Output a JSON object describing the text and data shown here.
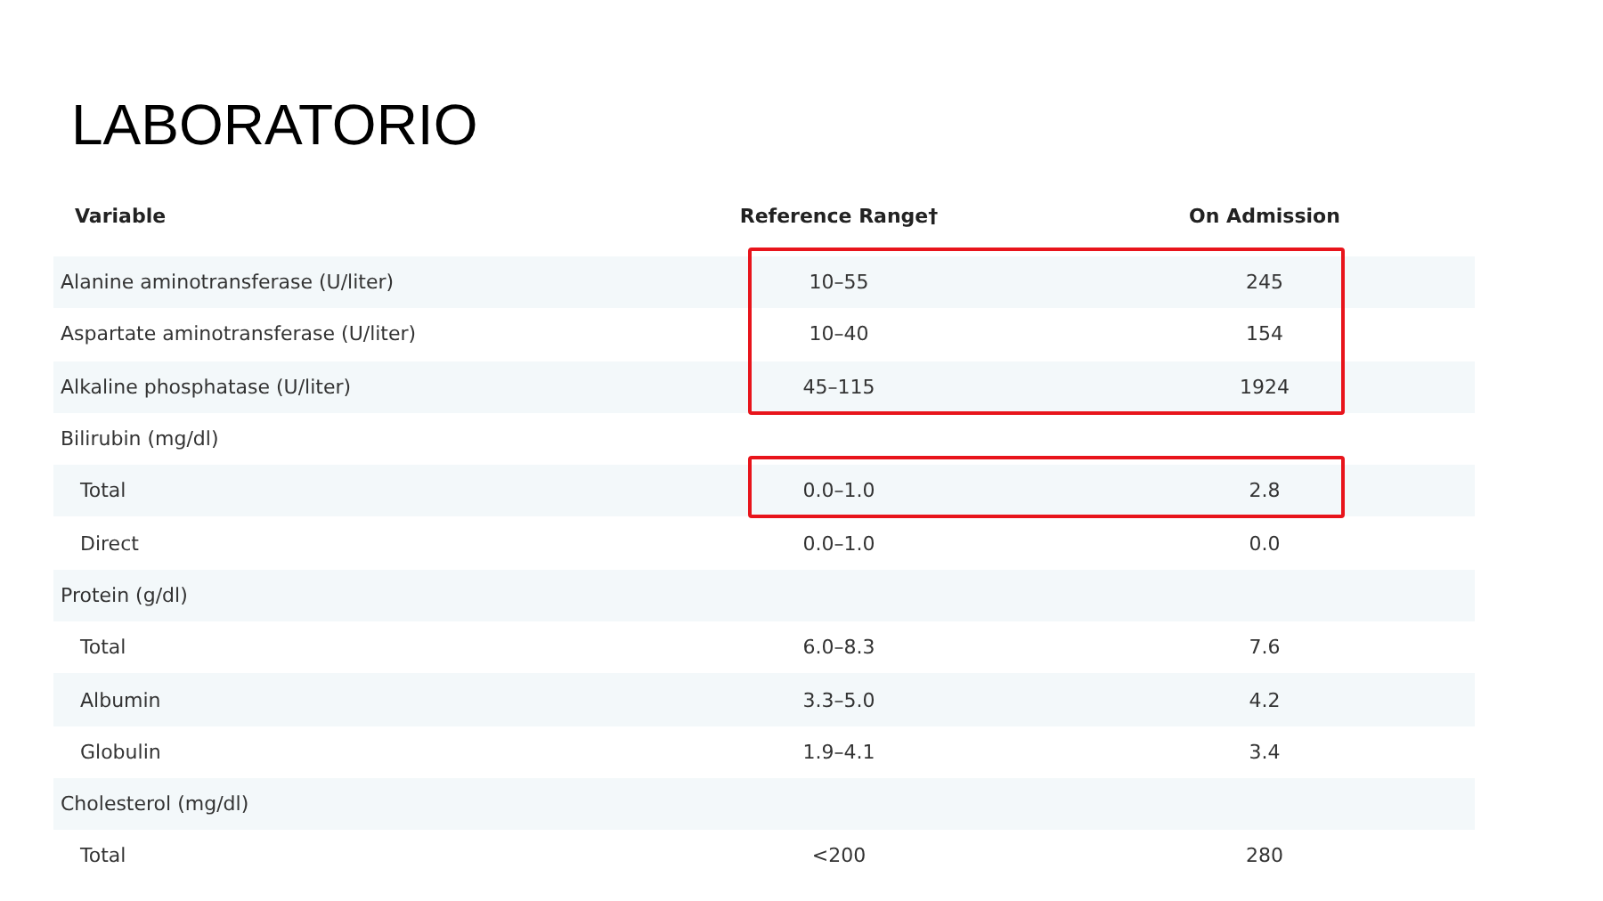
{
  "title": "LABORATORIO",
  "table": {
    "columns": [
      "Variable",
      "Reference Range†",
      "On Admission"
    ],
    "rows": [
      {
        "variable": "Alanine aminotransferase (U/liter)",
        "reference": "10–55",
        "admission": "245",
        "highlighted": true
      },
      {
        "variable": "Aspartate aminotransferase (U/liter)",
        "reference": "10–40",
        "admission": "154",
        "highlighted": true
      },
      {
        "variable": "Alkaline phosphatase (U/liter)",
        "reference": "45–115",
        "admission": "1924",
        "highlighted": true
      },
      {
        "variable": "Bilirubin (mg/dl)",
        "highlighted": false,
        "children": [
          {
            "variable": "Total",
            "reference": "0.0–1.0",
            "admission": "2.8",
            "highlighted": true
          },
          {
            "variable": "Direct",
            "reference": "0.0–1.0",
            "admission": "0.0",
            "highlighted": false
          }
        ]
      },
      {
        "variable": "Protein (g/dl)",
        "highlighted": false,
        "children": [
          {
            "variable": "Total",
            "reference": "6.0–8.3",
            "admission": "7.6",
            "highlighted": false
          },
          {
            "variable": "Albumin",
            "reference": "3.3–5.0",
            "admission": "4.2",
            "highlighted": false
          },
          {
            "variable": "Globulin",
            "reference": "1.9–4.1",
            "admission": "3.4",
            "highlighted": false
          }
        ]
      },
      {
        "variable": "Cholesterol (mg/dl)",
        "highlighted": false,
        "children": [
          {
            "variable": "Total",
            "reference": "<200",
            "admission": "280",
            "highlighted": false
          }
        ]
      }
    ]
  }
}
